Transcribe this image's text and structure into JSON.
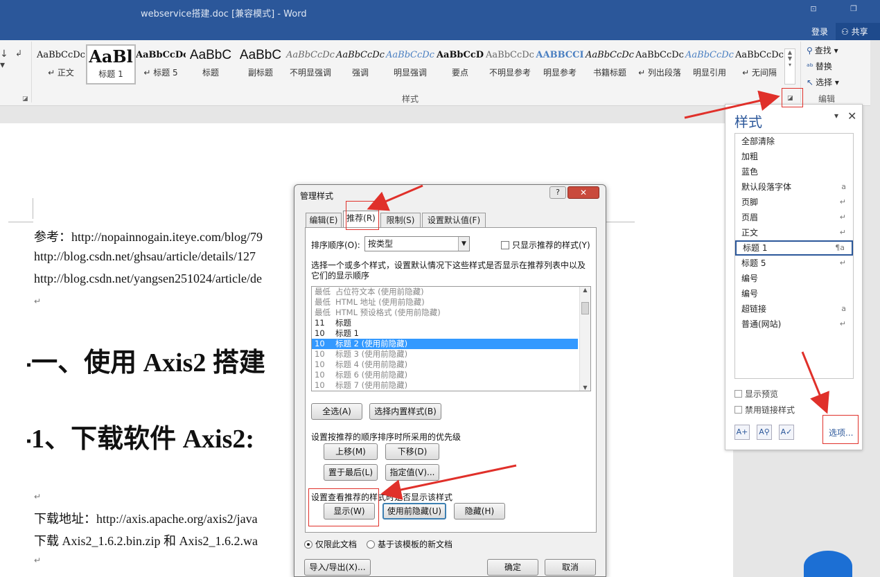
{
  "window": {
    "title": "webservice搭建.doc [兼容模式] - Word",
    "login": "登录",
    "share": "共享"
  },
  "ribbon": {
    "styles_group_label": "样式",
    "edit_group_label": "编辑",
    "gallery": [
      {
        "preview": "AaBbCcDc",
        "label": "↵ 正文"
      },
      {
        "preview": "AaBl",
        "label": "标题 1"
      },
      {
        "preview": "AaBbCcDc",
        "label": "↵ 标题 5"
      },
      {
        "preview": "AaBbC",
        "label": "标题"
      },
      {
        "preview": "AaBbC",
        "label": "副标题"
      },
      {
        "preview": "AaBbCcDc",
        "label": "不明显强调"
      },
      {
        "preview": "AaBbCcDc",
        "label": "强调"
      },
      {
        "preview": "AaBbCcDc",
        "label": "明显强调"
      },
      {
        "preview": "AaBbCcD",
        "label": "要点"
      },
      {
        "preview": "AaBbCcDc",
        "label": "不明显参考"
      },
      {
        "preview": "AABBCCI",
        "label": "明显参考"
      },
      {
        "preview": "AaBbCcDc",
        "label": "书籍标题"
      },
      {
        "preview": "AaBbCcDc",
        "label": "↵ 列出段落"
      },
      {
        "preview": "AaBbCcDc",
        "label": "明显引用"
      },
      {
        "preview": "AaBbCcDc",
        "label": "↵ 无间隔"
      }
    ],
    "find": "查找",
    "replace": "替换",
    "select": "选择"
  },
  "document": {
    "ref_line": "参考：http://nopainnogain.iteye.com/blog/79",
    "link2": "http://blog.csdn.net/ghsau/article/details/127",
    "link3": "http://blog.csdn.net/yangsen251024/article/de",
    "heading1": "一、使用 Axis2 搭建",
    "heading2": "1、下载软件 Axis2:",
    "download_line": "下载地址：http://axis.apache.org/axis2/java",
    "download_line2": "下载 Axis2_1.6.2.bin.zip 和 Axis2_1.6.2.wa",
    "para_mark": "↵"
  },
  "styles_pane": {
    "title": "样式",
    "items": [
      {
        "name": "全部清除",
        "sym": ""
      },
      {
        "name": "加粗",
        "sym": ""
      },
      {
        "name": "蓝色",
        "sym": ""
      },
      {
        "name": "默认段落字体",
        "sym": "a"
      },
      {
        "name": "页脚",
        "sym": "↵"
      },
      {
        "name": "页眉",
        "sym": "↵"
      },
      {
        "name": "正文",
        "sym": "↵"
      },
      {
        "name": "标题 1",
        "sym": "¶a"
      },
      {
        "name": "标题 5",
        "sym": "↵"
      },
      {
        "name": "编号",
        "sym": ""
      },
      {
        "name": "编号",
        "sym": ""
      },
      {
        "name": "超链接",
        "sym": "a"
      },
      {
        "name": "普通(网站)",
        "sym": "↵"
      }
    ],
    "show_preview": "显示预览",
    "disable_linked": "禁用链接样式",
    "options": "选项..."
  },
  "dialog": {
    "title": "管理样式",
    "help": "?",
    "close": "✕",
    "tabs": [
      "编辑(E)",
      "推荐(R)",
      "限制(S)",
      "设置默认值(F)"
    ],
    "sort_label": "排序顺序(O):",
    "sort_value": "按类型",
    "only_recommended": "只显示推荐的样式(Y)",
    "description": "选择一个或多个样式，设置默认情况下这些样式是否显示在推荐列表中以及它们的显示顺序",
    "list": [
      {
        "priority": "最低",
        "name": "占位符文本 (使用前隐藏)",
        "dim": true
      },
      {
        "priority": "最低",
        "name": "HTML 地址 (使用前隐藏)",
        "dim": true
      },
      {
        "priority": "最低",
        "name": "HTML 预设格式 (使用前隐藏)",
        "dim": true
      },
      {
        "priority": "11",
        "name": "标题",
        "dim": false
      },
      {
        "priority": "10",
        "name": "标题 1",
        "dim": false
      },
      {
        "priority": "10",
        "name": "标题 2 (使用前隐藏)",
        "dim": false,
        "selected": true
      },
      {
        "priority": "10",
        "name": "标题 3 (使用前隐藏)",
        "dim": true
      },
      {
        "priority": "10",
        "name": "标题 4 (使用前隐藏)",
        "dim": true
      },
      {
        "priority": "10",
        "name": "标题 6 (使用前隐藏)",
        "dim": true
      },
      {
        "priority": "10",
        "name": "标题 7 (使用前隐藏)",
        "dim": true
      }
    ],
    "select_all": "全选(A)",
    "select_builtin": "选择内置样式(B)",
    "priority_label": "设置按推荐的顺序排序时所采用的优先级",
    "move_up": "上移(M)",
    "move_down": "下移(D)",
    "move_last": "置于最后(L)",
    "assign_value": "指定值(V)...",
    "visibility_label": "设置查看推荐的样式时是否显示该样式",
    "show": "显示(W)",
    "hide_until_used": "使用前隐藏(U)",
    "hide": "隐藏(H)",
    "only_this_doc": "仅限此文档",
    "new_docs_template": "基于该模板的新文档",
    "import_export": "导入/导出(X)...",
    "ok": "确定",
    "cancel": "取消"
  }
}
